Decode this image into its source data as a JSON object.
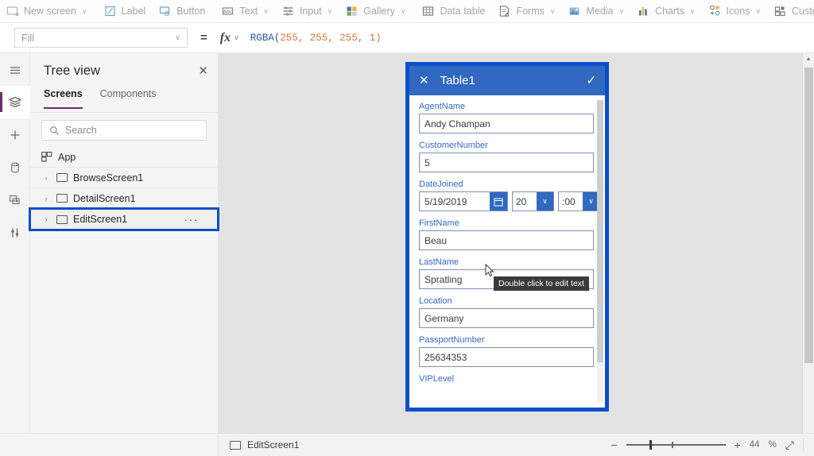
{
  "ribbon": {
    "items": [
      {
        "label": "New screen",
        "icon": "new-screen-icon",
        "chevron": "∨"
      },
      {
        "label": "Label",
        "icon": "label-icon",
        "chevron": ""
      },
      {
        "label": "Button",
        "icon": "button-icon",
        "chevron": ""
      },
      {
        "label": "Text",
        "icon": "text-icon",
        "chevron": "∨"
      },
      {
        "label": "Input",
        "icon": "input-icon",
        "chevron": "∨"
      },
      {
        "label": "Gallery",
        "icon": "gallery-icon",
        "chevron": "∨"
      },
      {
        "label": "Data table",
        "icon": "data-table-icon",
        "chevron": ""
      },
      {
        "label": "Forms",
        "icon": "forms-icon",
        "chevron": "∨"
      },
      {
        "label": "Media",
        "icon": "media-icon",
        "chevron": "∨"
      },
      {
        "label": "Charts",
        "icon": "charts-icon",
        "chevron": "∨"
      },
      {
        "label": "Icons",
        "icon": "icons-icon",
        "chevron": "∨"
      },
      {
        "label": "Custom",
        "icon": "custom-icon",
        "chevron": "∨"
      }
    ]
  },
  "formula_bar": {
    "property": "Fill",
    "property_chevron": "∨",
    "equals": "=",
    "fx": "fx",
    "fx_chevron": "∨",
    "formula_fn": "RGBA(",
    "formula_args": "255, 255, 255, 1",
    "formula_close": ")"
  },
  "rail": {
    "items": [
      {
        "name": "hamburger-menu-icon",
        "selected": false
      },
      {
        "name": "tree-view-icon",
        "selected": true
      },
      {
        "name": "insert-icon",
        "selected": false
      },
      {
        "name": "data-icon",
        "selected": false
      },
      {
        "name": "media-library-icon",
        "selected": false
      },
      {
        "name": "advanced-settings-icon",
        "selected": false
      }
    ]
  },
  "tree_view": {
    "title": "Tree view",
    "close": "✕",
    "tabs": [
      {
        "label": "Screens",
        "active": true
      },
      {
        "label": "Components",
        "active": false
      }
    ],
    "search_placeholder": "Search",
    "app_item": "App",
    "screens": [
      {
        "label": "BrowseScreen1",
        "arrow": "›",
        "selected": false,
        "dots": ""
      },
      {
        "label": "DetailScreen1",
        "arrow": "›",
        "selected": false,
        "dots": ""
      },
      {
        "label": "EditScreen1",
        "arrow": "›",
        "selected": true,
        "dots": "···"
      }
    ]
  },
  "form": {
    "header_title": "Table1",
    "cancel_icon": "✕",
    "save_icon": "✓",
    "header_color": "#3168c0",
    "selection_color": "#0b4fc8",
    "fields": [
      {
        "label": "AgentName",
        "value": "Andy Champan",
        "type": "text"
      },
      {
        "label": "CustomerNumber",
        "value": "5",
        "type": "text"
      },
      {
        "label": "DateJoined",
        "value": "5/19/2019",
        "type": "datetime",
        "hour": "20",
        "minute": ":00",
        "hour_chevron": "∨",
        "minute_chevron": "∨"
      },
      {
        "label": "FirstName",
        "value": "Beau",
        "type": "text"
      },
      {
        "label": "LastName",
        "value": "Spratling",
        "type": "text"
      },
      {
        "label": "Location",
        "value": "Germany",
        "type": "text"
      },
      {
        "label": "PassportNumber",
        "value": "25634353",
        "type": "text"
      },
      {
        "label": "VIPLevel",
        "value": "",
        "type": "text"
      }
    ],
    "tooltip": "Double click to edit text"
  },
  "status_bar": {
    "screen_name": "EditScreen1",
    "zoom_out": "−",
    "zoom_in": "+",
    "zoom_value": "44",
    "zoom_unit": "%",
    "fit_icon": "⤢"
  }
}
